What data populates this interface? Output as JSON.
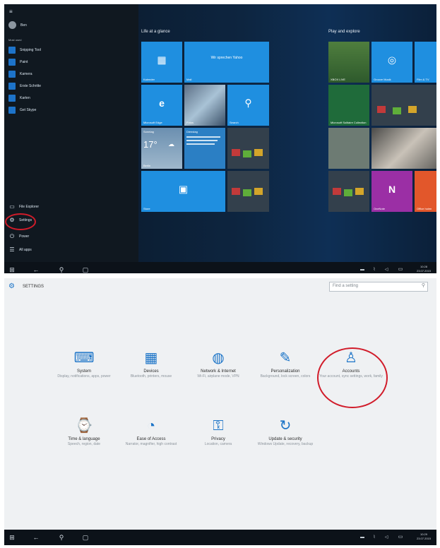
{
  "start_menu": {
    "user_name": "Ben",
    "most_used_header": "Most used",
    "apps": [
      {
        "label": "Snipping Tool",
        "icon": "scissors-icon"
      },
      {
        "label": "Paint",
        "icon": "palette-icon"
      },
      {
        "label": "Kamera",
        "icon": "camera-icon"
      },
      {
        "label": "Erste Schritte",
        "icon": "lightbulb-icon"
      },
      {
        "label": "Karten",
        "icon": "map-icon"
      },
      {
        "label": "Get Skype",
        "icon": "skype-icon"
      }
    ],
    "system": [
      {
        "label": "File Explorer",
        "icon": "folder-icon"
      },
      {
        "label": "Settings",
        "icon": "gear-icon"
      },
      {
        "label": "Power",
        "icon": "power-icon"
      },
      {
        "label": "All apps",
        "icon": "list-icon"
      }
    ]
  },
  "tiles": {
    "group1_header": "Life at a glance",
    "group2_header": "Play and explore",
    "kalender": "Kalender",
    "mail_title": "Wir sprechen Yahoo",
    "mail": "Mail",
    "edge": "Microsoft Edge",
    "fotos": "Fotos",
    "search": "Search",
    "weather_day": "Sonntag",
    "weather_temp": "17°",
    "weather_city": "Berlin",
    "news_head": "Dienstag",
    "store": "Store",
    "xbox_live": "XBOX LIVE",
    "groove": "Groove Musik",
    "film": "Film & TV",
    "solitaire": "Microsoft Solitaire Collection",
    "onenote": "OneNote",
    "office": "Office holen"
  },
  "taskbar_top": {
    "time": "10:28",
    "date": "23.07.2015"
  },
  "settings": {
    "header": "SETTINGS",
    "search_placeholder": "Find a setting",
    "items": [
      {
        "title": "System",
        "desc": "Display, notifications, apps, power",
        "icon": "laptop-icon"
      },
      {
        "title": "Devices",
        "desc": "Bluetooth, printers, mouse",
        "icon": "keyboard-icon"
      },
      {
        "title": "Network & Internet",
        "desc": "Wi-Fi, airplane mode, VPN",
        "icon": "globe-icon"
      },
      {
        "title": "Personalization",
        "desc": "Background, lock screen, colors",
        "icon": "paintbrush-icon"
      },
      {
        "title": "Accounts",
        "desc": "Your account, sync settings, work, family",
        "icon": "person-icon"
      },
      {
        "title": "Time & language",
        "desc": "Speech, region, date",
        "icon": "clock-language-icon"
      },
      {
        "title": "Ease of Access",
        "desc": "Narrator, magnifier, high contrast",
        "icon": "accessibility-icon"
      },
      {
        "title": "Privacy",
        "desc": "Location, camera",
        "icon": "lock-icon"
      },
      {
        "title": "Update & security",
        "desc": "Windows Update, recovery, backup",
        "icon": "refresh-icon"
      }
    ]
  },
  "taskbar_bottom": {
    "time": "10:29",
    "date": "23.07.2015"
  },
  "colors": {
    "accent": "#1f8fe0",
    "highlight_circle": "#d11c2a",
    "settings_icon": "#1a73c7"
  }
}
